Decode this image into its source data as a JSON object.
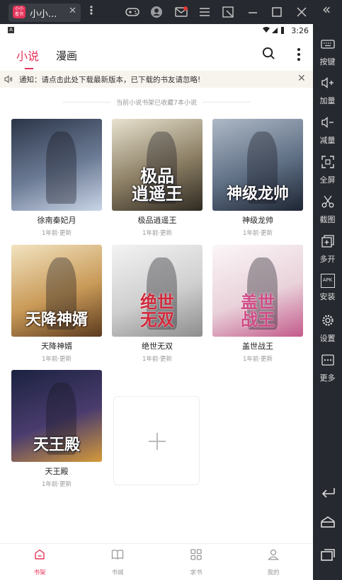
{
  "emulator": {
    "app_tab_title": "小小...",
    "app_logo_text": "小小\n看书",
    "close_symbol": "✕",
    "collapse_symbol": "«",
    "sidebar": [
      {
        "label": "按键",
        "icon": "keyboard-icon"
      },
      {
        "label": "加量",
        "icon": "volume-up-icon"
      },
      {
        "label": "减量",
        "icon": "volume-down-icon"
      },
      {
        "label": "全屏",
        "icon": "fullscreen-icon"
      },
      {
        "label": "截图",
        "icon": "scissors-icon"
      },
      {
        "label": "多开",
        "icon": "multi-open-icon"
      },
      {
        "label": "安装",
        "icon": "apk-icon"
      },
      {
        "label": "设置",
        "icon": "gear-icon"
      },
      {
        "label": "更多",
        "icon": "more-icon"
      }
    ],
    "apk_badge": "APK"
  },
  "status_bar": {
    "badge": "A",
    "time": "3:26"
  },
  "header": {
    "tab_novel": "小说",
    "tab_comic": "漫画"
  },
  "notice": {
    "text": "通知：请点击此处下载最新版本，已下载的书友请忽略!",
    "close": "✕"
  },
  "shelf": {
    "info": "当前小说书架已收藏7本小说",
    "books": [
      {
        "title": "徐南秦妃月",
        "updated": "1年前·更新",
        "cover_text": "",
        "colors": [
          "#2b3548",
          "#6c7b95",
          "#c9d4e6"
        ]
      },
      {
        "title": "极品逍遥王",
        "updated": "1年前·更新",
        "cover_text": "极品\n逍遥王",
        "colors": [
          "#e8e2cf",
          "#8a7d63",
          "#2f2a22"
        ]
      },
      {
        "title": "神级龙帅",
        "updated": "1年前·更新",
        "cover_text": "神级龙帅",
        "colors": [
          "#aeb9c7",
          "#5f6f84",
          "#1e2533"
        ]
      },
      {
        "title": "天降神婿",
        "updated": "1年前·更新",
        "cover_text": "天降神婿",
        "colors": [
          "#f2e3c0",
          "#c99a58",
          "#5b3a1e"
        ]
      },
      {
        "title": "绝世无双",
        "updated": "1年前·更新",
        "cover_text": "绝世\n无双",
        "colors": [
          "#f3f3f3",
          "#cfcfcf",
          "#8d8d8d"
        ]
      },
      {
        "title": "盖世战王",
        "updated": "1年前·更新",
        "cover_text": "盖世\n战王",
        "colors": [
          "#fbf6f7",
          "#e9d2da",
          "#c35a8b"
        ]
      },
      {
        "title": "天王殿",
        "updated": "1年前·更新",
        "cover_text": "天王殿",
        "colors": [
          "#1b2240",
          "#4a3c6e",
          "#d59a3a"
        ]
      }
    ]
  },
  "bottom_nav": [
    {
      "label": "书架",
      "icon": "bookshelf-icon",
      "active": true
    },
    {
      "label": "书城",
      "icon": "book-icon",
      "active": false
    },
    {
      "label": "求书",
      "icon": "grid-icon",
      "active": false
    },
    {
      "label": "我的",
      "icon": "user-icon",
      "active": false
    }
  ],
  "colors": {
    "accent": "#e6335a"
  }
}
